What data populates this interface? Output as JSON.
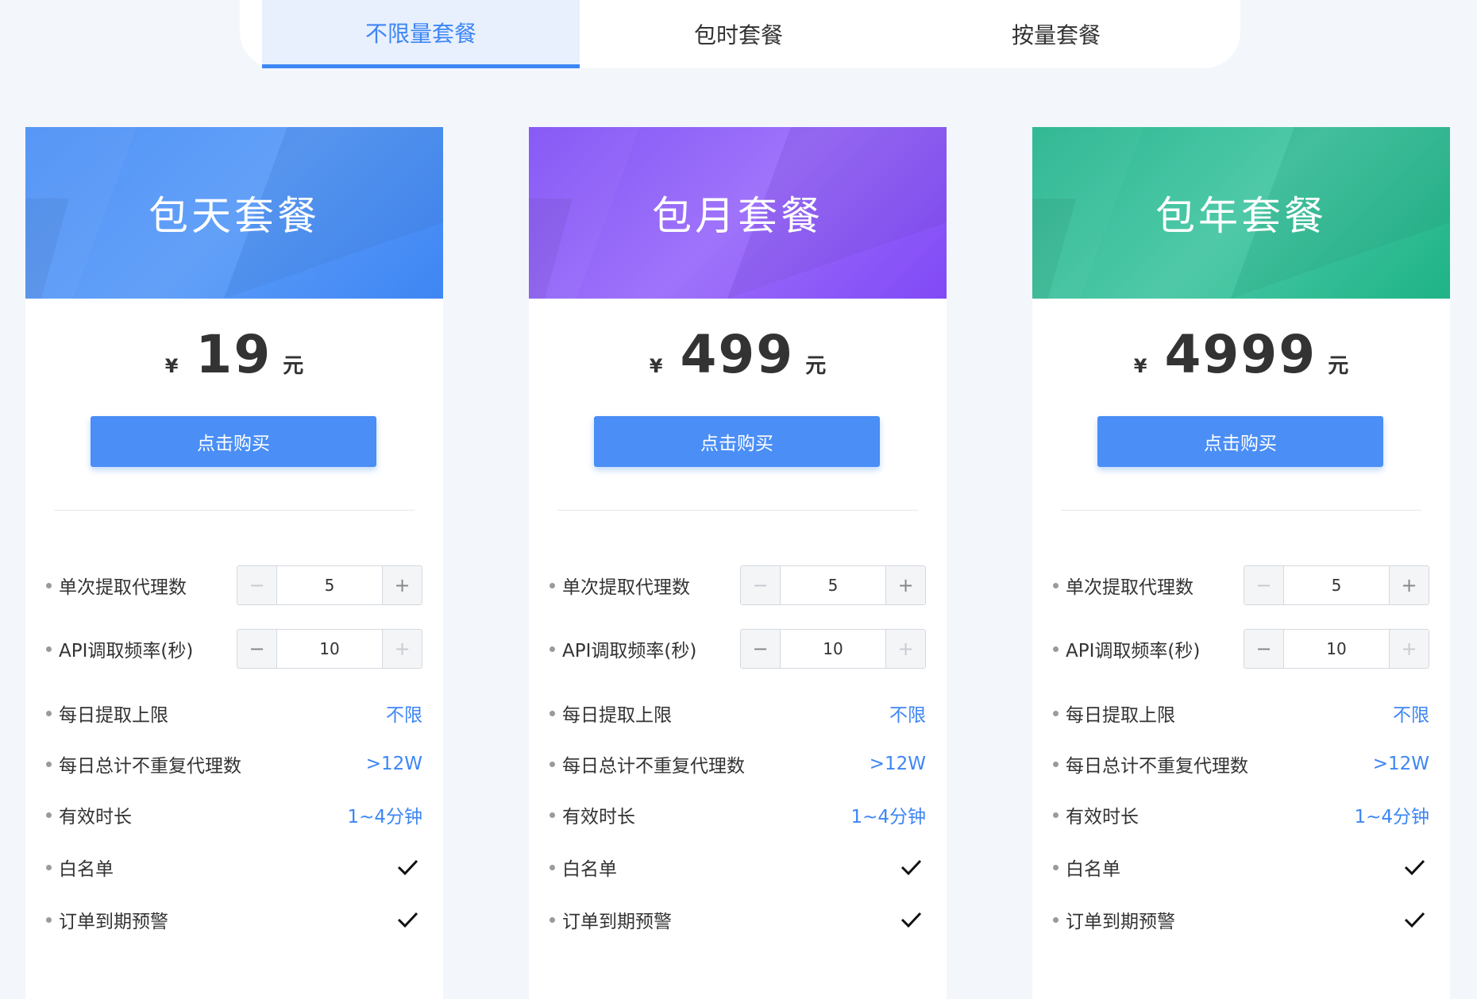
{
  "tabs": [
    {
      "label": "不限量套餐",
      "active": true
    },
    {
      "label": "包时套餐",
      "active": false
    },
    {
      "label": "按量套餐",
      "active": false
    }
  ],
  "accent_color": "#3d86f5",
  "cards": [
    {
      "title": "包天套餐",
      "banner_color": "#4a8ef6",
      "currency": "¥",
      "price": "19",
      "unit": "元",
      "buy_label": "点击购买",
      "features": {
        "per_extract": {
          "label": "单次提取代理数",
          "value": "5",
          "minus": "−",
          "plus": "+"
        },
        "api_freq": {
          "label": "API调取频率(秒)",
          "value": "10",
          "minus": "−",
          "plus": "+"
        },
        "daily_limit": {
          "label": "每日提取上限",
          "value": "不限"
        },
        "daily_unique": {
          "label": "每日总计不重复代理数",
          "value": ">12W"
        },
        "valid_time": {
          "label": "有效时长",
          "value": "1~4分钟"
        },
        "whitelist": {
          "label": "白名单",
          "icon": "checkmark-icon"
        },
        "expiry_alert": {
          "label": "订单到期预警",
          "icon": "checkmark-icon"
        }
      }
    },
    {
      "title": "包月套餐",
      "banner_color": "#8b5cf6",
      "currency": "¥",
      "price": "499",
      "unit": "元",
      "buy_label": "点击购买",
      "features": {
        "per_extract": {
          "label": "单次提取代理数",
          "value": "5",
          "minus": "−",
          "plus": "+"
        },
        "api_freq": {
          "label": "API调取频率(秒)",
          "value": "10",
          "minus": "−",
          "plus": "+"
        },
        "daily_limit": {
          "label": "每日提取上限",
          "value": "不限"
        },
        "daily_unique": {
          "label": "每日总计不重复代理数",
          "value": ">12W"
        },
        "valid_time": {
          "label": "有效时长",
          "value": "1~4分钟"
        },
        "whitelist": {
          "label": "白名单",
          "icon": "checkmark-icon"
        },
        "expiry_alert": {
          "label": "订单到期预警",
          "icon": "checkmark-icon"
        }
      }
    },
    {
      "title": "包年套餐",
      "banner_color": "#2bb890",
      "currency": "¥",
      "price": "4999",
      "unit": "元",
      "buy_label": "点击购买",
      "features": {
        "per_extract": {
          "label": "单次提取代理数",
          "value": "5",
          "minus": "−",
          "plus": "+"
        },
        "api_freq": {
          "label": "API调取频率(秒)",
          "value": "10",
          "minus": "−",
          "plus": "+"
        },
        "daily_limit": {
          "label": "每日提取上限",
          "value": "不限"
        },
        "daily_unique": {
          "label": "每日总计不重复代理数",
          "value": ">12W"
        },
        "valid_time": {
          "label": "有效时长",
          "value": "1~4分钟"
        },
        "whitelist": {
          "label": "白名单",
          "icon": "checkmark-icon"
        },
        "expiry_alert": {
          "label": "订单到期预警",
          "icon": "checkmark-icon"
        }
      }
    }
  ]
}
